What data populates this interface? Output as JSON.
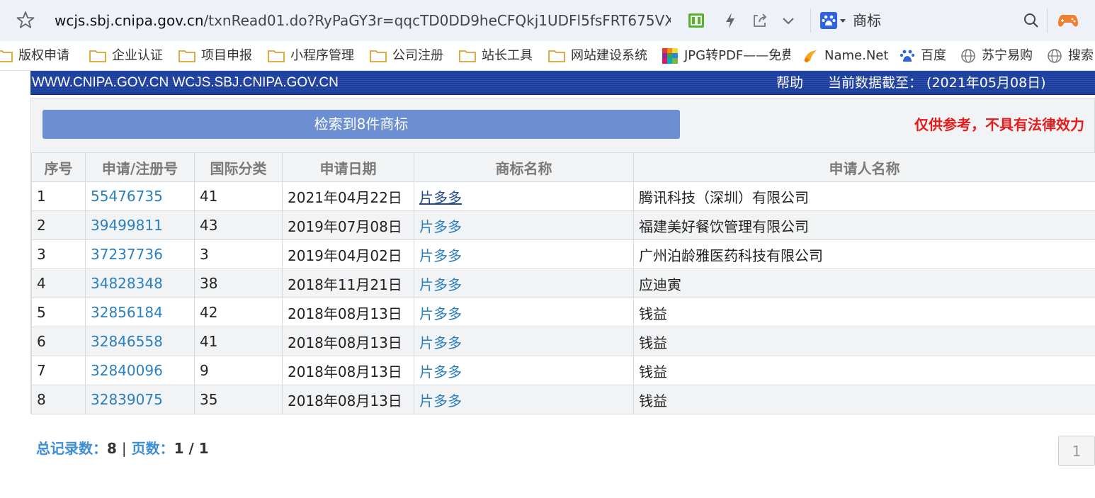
{
  "browser": {
    "url_host": "wcjs.sbj.cnipa.gov.cn",
    "url_path": "/txnRead01.do?RyPaGY3r=qqcTD0DD9heCFQkj1UDFl5fsFRT675VX",
    "search_engine_label": "商标"
  },
  "bookmarks": [
    {
      "label": "版权申请",
      "icon": "folder-icon"
    },
    {
      "label": "企业认证",
      "icon": "folder-icon"
    },
    {
      "label": "项目申报",
      "icon": "folder-icon"
    },
    {
      "label": "小程序管理",
      "icon": "folder-icon"
    },
    {
      "label": "公司注册",
      "icon": "folder-icon"
    },
    {
      "label": "站长工具",
      "icon": "folder-icon"
    },
    {
      "label": "网站建设系统",
      "icon": "folder-icon"
    },
    {
      "label": "JPG转PDF——免费",
      "icon": "pdf-tool-icon"
    },
    {
      "label": "Name.Net",
      "icon": "name-net-icon"
    },
    {
      "label": "百度",
      "icon": "baidu-paw-icon"
    },
    {
      "label": "苏宁易购",
      "icon": "globe-icon"
    },
    {
      "label": "搜索",
      "icon": "globe-icon"
    }
  ],
  "header": {
    "domains": "WWW.CNIPA.GOV.CN WCJS.SBJ.CNIPA.GOV.CN",
    "help": "帮助",
    "data_date": "当前数据截至：  (2021年05月08日)"
  },
  "results": {
    "found_label": "检索到8件商标",
    "disclaimer": "仅供参考，不具有法律效力",
    "columns": [
      "序号",
      "申请/注册号",
      "国际分类",
      "申请日期",
      "商标名称",
      "申请人名称"
    ],
    "rows": [
      [
        "1",
        "55476735",
        "41",
        "2021年04月22日",
        "片多多",
        "腾讯科技（深圳）有限公司"
      ],
      [
        "2",
        "39499811",
        "43",
        "2019年07月08日",
        "片多多",
        "福建美好餐饮管理有限公司"
      ],
      [
        "3",
        "37237736",
        "3",
        "2019年04月02日",
        "片多多",
        "广州泊龄雅医药科技有限公司"
      ],
      [
        "4",
        "34828348",
        "38",
        "2018年11月21日",
        "片多多",
        "应迪寅"
      ],
      [
        "5",
        "32856184",
        "42",
        "2018年08月13日",
        "片多多",
        "钱益"
      ],
      [
        "6",
        "32846558",
        "41",
        "2018年08月13日",
        "片多多",
        "钱益"
      ],
      [
        "7",
        "32840096",
        "9",
        "2018年08月13日",
        "片多多",
        "钱益"
      ],
      [
        "8",
        "32839075",
        "35",
        "2018年08月13日",
        "片多多",
        "钱益"
      ]
    ]
  },
  "footer": {
    "total_label": "总记录数：",
    "total_value": "8",
    "separator": "|",
    "pages_label": "页数：",
    "pages_value": "1 / 1",
    "page_button": "1"
  },
  "colors": {
    "header_strip": "#1a3d9e",
    "result_bar": "#6b8fd2",
    "link": "#2a7fc1",
    "disclaimer": "#e41b1b"
  }
}
